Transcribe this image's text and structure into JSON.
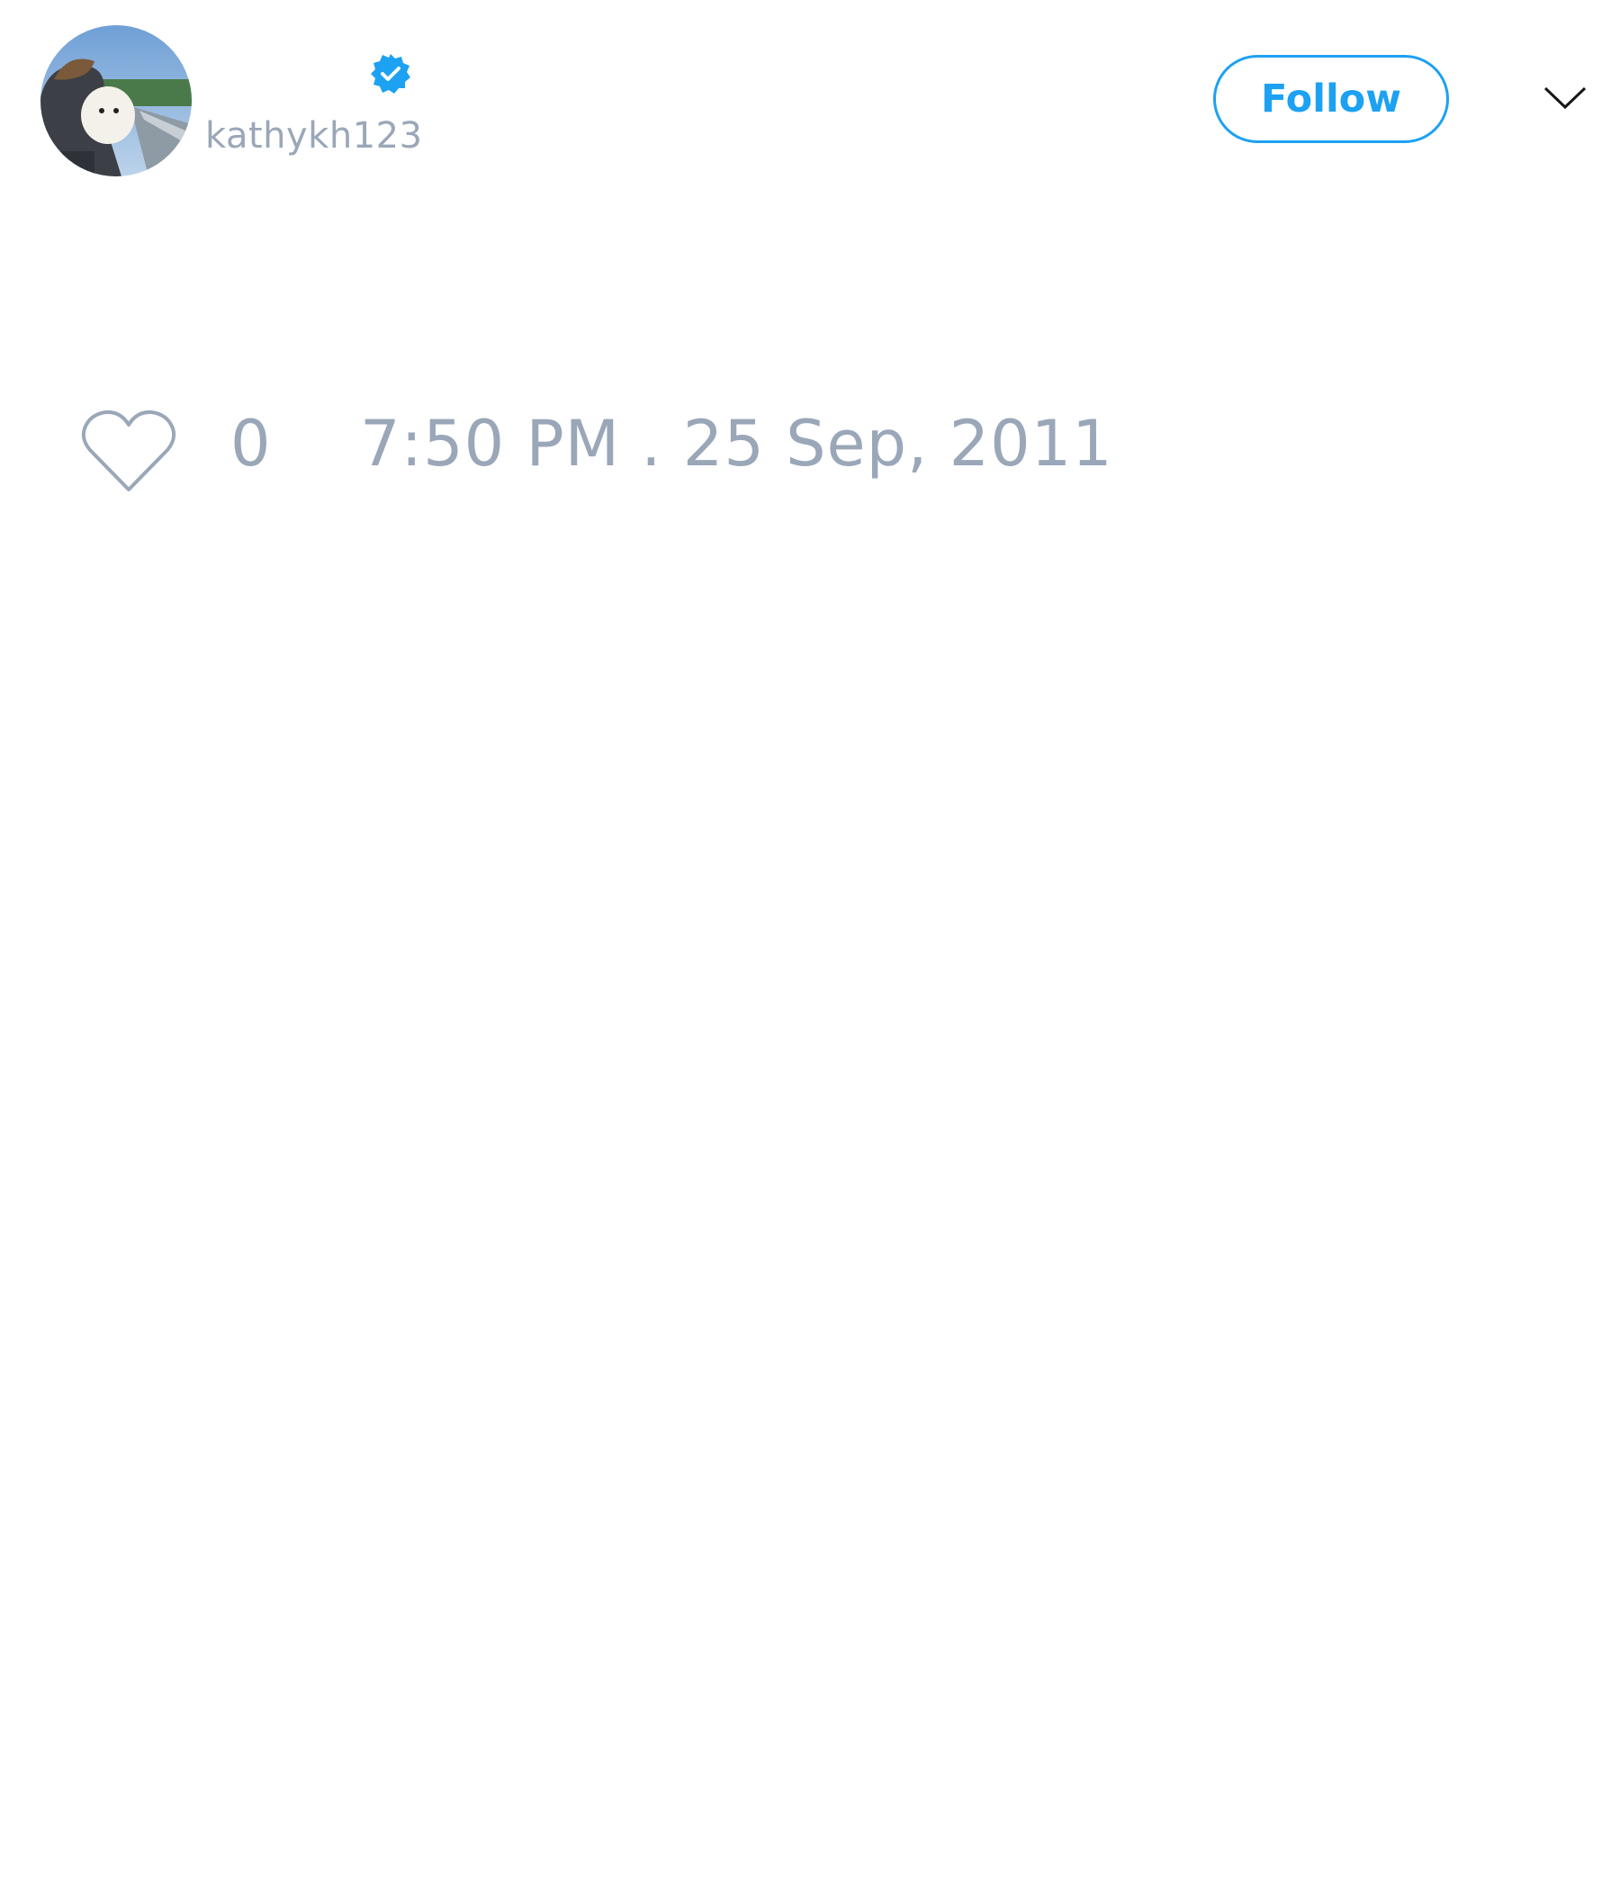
{
  "tweet": {
    "user": {
      "display_name": "",
      "handle": "kathykh123",
      "verified": true,
      "avatar_icon": "avatar-photo"
    },
    "follow_label": "Follow",
    "menu_icon": "chevron-down-icon",
    "likes": {
      "icon": "heart-icon",
      "count": "0"
    },
    "timestamp": "7:50 PM . 25 Sep, 2011"
  },
  "colors": {
    "accent": "#1da1f2",
    "muted_text": "#9aa7b8",
    "background": "#ffffff"
  }
}
